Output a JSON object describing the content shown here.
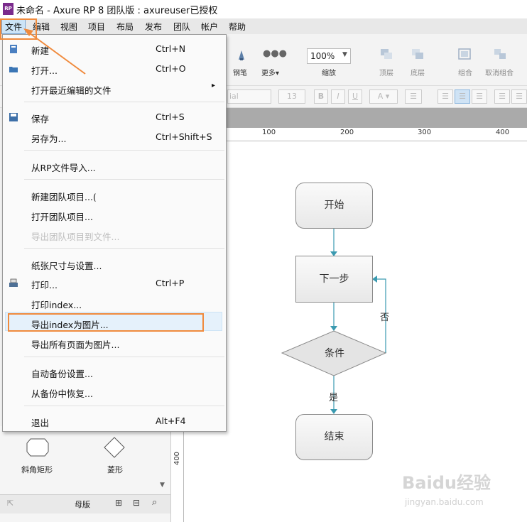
{
  "window": {
    "title": "未命名 - Axure RP 8 团队版 : axureuser已授权",
    "logo": "RP"
  },
  "menubar": [
    "文件",
    "编辑",
    "视图",
    "项目",
    "布局",
    "发布",
    "团队",
    "帐户",
    "帮助"
  ],
  "toolbar": {
    "labels": [
      "钢笔",
      "更多▾",
      "缩放",
      "顶层",
      "底层",
      "组合",
      "取消组合"
    ],
    "zoom": "100%"
  },
  "formatbar": {
    "font": "ial",
    "size": "13"
  },
  "ruler": [
    "100",
    "200",
    "300",
    "400"
  ],
  "vruler": "400",
  "left_panel": {
    "shapes": [
      "斜角矩形",
      "菱形"
    ],
    "masters_title": "母版"
  },
  "file_menu": {
    "items": [
      {
        "label": "新建",
        "shortcut": "Ctrl+N"
      },
      {
        "label": "打开...",
        "shortcut": "Ctrl+O"
      },
      {
        "label": "打开最近编辑的文件",
        "shortcut": "▸"
      },
      {
        "label": "保存",
        "shortcut": "Ctrl+S"
      },
      {
        "label": "另存为...",
        "shortcut": "Ctrl+Shift+S"
      },
      {
        "label": "从RP文件导入...",
        "shortcut": ""
      },
      {
        "label": "新建团队项目...(",
        "shortcut": ""
      },
      {
        "label": "打开团队项目...",
        "shortcut": ""
      },
      {
        "label": "导出团队项目到文件...",
        "shortcut": ""
      },
      {
        "label": "纸张尺寸与设置...",
        "shortcut": ""
      },
      {
        "label": "打印...",
        "shortcut": "Ctrl+P"
      },
      {
        "label": "打印index...",
        "shortcut": ""
      },
      {
        "label": "导出index为图片...",
        "shortcut": ""
      },
      {
        "label": "导出所有页面为图片...",
        "shortcut": ""
      },
      {
        "label": "自动备份设置...",
        "shortcut": ""
      },
      {
        "label": "从备份中恢复...",
        "shortcut": ""
      },
      {
        "label": "退出",
        "shortcut": "Alt+F4"
      }
    ]
  },
  "flowchart": {
    "start": "开始",
    "next": "下一步",
    "condition": "条件",
    "end": "结束",
    "no": "否",
    "yes": "是"
  },
  "watermark": {
    "brand": "Baidu经验",
    "url": "jingyan.baidu.com"
  },
  "colors": {
    "accent": "#f08a3c",
    "connector": "#3a9ab0"
  }
}
